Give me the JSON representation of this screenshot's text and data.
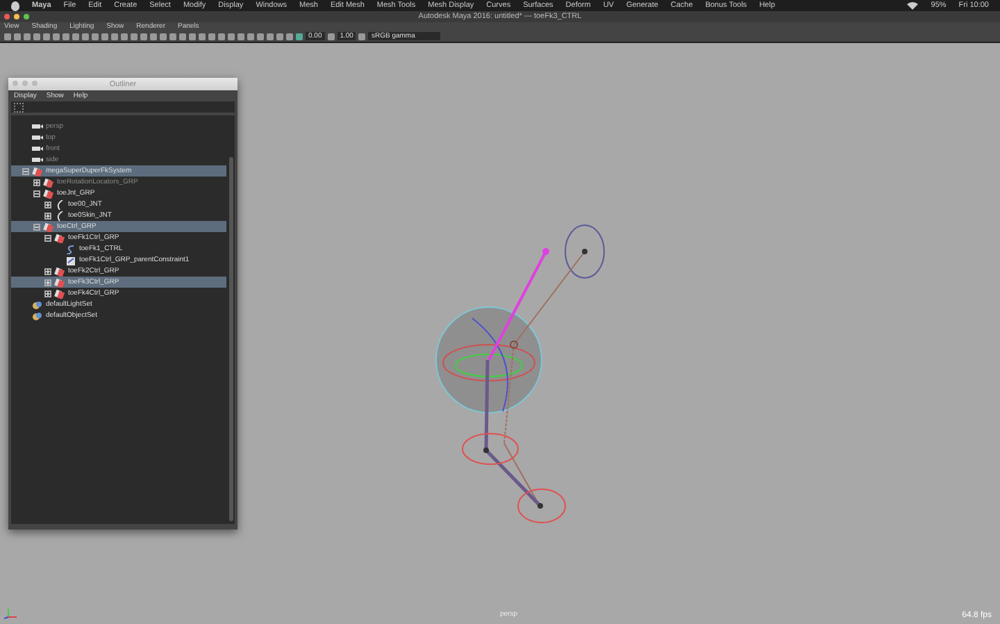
{
  "menu_bar": {
    "items": [
      "Maya",
      "File",
      "Edit",
      "Create",
      "Select",
      "Modify",
      "Display",
      "Windows",
      "Mesh",
      "Edit Mesh",
      "Mesh Tools",
      "Mesh Display",
      "Curves",
      "Surfaces",
      "Deform",
      "UV",
      "Generate",
      "Cache",
      "Bonus Tools",
      "Help"
    ],
    "battery": "95%",
    "clock": "Fri 10:00"
  },
  "window": {
    "title": "Autodesk Maya 2016: untitled*   ---   toeFk3_CTRL"
  },
  "panel_menu": [
    "View",
    "Shading",
    "Lighting",
    "Show",
    "Renderer",
    "Panels"
  ],
  "toolbar": {
    "exposure": "0.00",
    "gamma": "1.00",
    "color_space": "sRGB gamma"
  },
  "outliner": {
    "title": "Outliner",
    "menu": [
      "Display",
      "Show",
      "Help"
    ],
    "tree": [
      {
        "label": "persp",
        "kind": "camera",
        "dimmed": true,
        "selected": false
      },
      {
        "label": "top",
        "kind": "camera",
        "dimmed": true,
        "selected": false
      },
      {
        "label": "front",
        "kind": "camera",
        "dimmed": true,
        "selected": false
      },
      {
        "label": "side",
        "kind": "camera",
        "dimmed": true,
        "selected": false
      },
      {
        "label": "megaSuperDuperFkSystem",
        "kind": "group",
        "dimmed": false,
        "selected": true,
        "expanded": true,
        "children": [
          {
            "label": "toeRotationLocators_GRP",
            "kind": "group",
            "dimmed": true,
            "selected": false,
            "expanded": false
          },
          {
            "label": "toeJnt_GRP",
            "kind": "group",
            "dimmed": false,
            "selected": false,
            "expanded": true,
            "children": [
              {
                "label": "toe00_JNT",
                "kind": "joint",
                "dimmed": false,
                "selected": false,
                "expanded": false
              },
              {
                "label": "toe0Skin_JNT",
                "kind": "joint",
                "dimmed": false,
                "selected": false,
                "expanded": false
              }
            ]
          },
          {
            "label": "toeCtrl_GRP",
            "kind": "group",
            "dimmed": false,
            "selected": true,
            "expanded": true,
            "children": [
              {
                "label": "toeFk1Ctrl_GRP",
                "kind": "group",
                "dimmed": false,
                "selected": false,
                "expanded": true,
                "children": [
                  {
                    "label": "toeFk1_CTRL",
                    "kind": "curve",
                    "dimmed": false,
                    "selected": false
                  },
                  {
                    "label": "toeFk1Ctrl_GRP_parentConstraint1",
                    "kind": "constraint",
                    "dimmed": false,
                    "selected": false
                  }
                ]
              },
              {
                "label": "toeFk2Ctrl_GRP",
                "kind": "group",
                "dimmed": false,
                "selected": false,
                "expanded": false
              },
              {
                "label": "toeFk3Ctrl_GRP",
                "kind": "group",
                "dimmed": false,
                "selected": true,
                "expanded": false
              },
              {
                "label": "toeFk4Ctrl_GRP",
                "kind": "group",
                "dimmed": false,
                "selected": false,
                "expanded": false
              }
            ]
          }
        ]
      },
      {
        "label": "defaultLightSet",
        "kind": "set",
        "dimmed": false,
        "selected": false
      },
      {
        "label": "defaultObjectSet",
        "kind": "set",
        "dimmed": false,
        "selected": false
      }
    ]
  },
  "viewport": {
    "camera": "persp",
    "fps": "64.8 fps"
  }
}
